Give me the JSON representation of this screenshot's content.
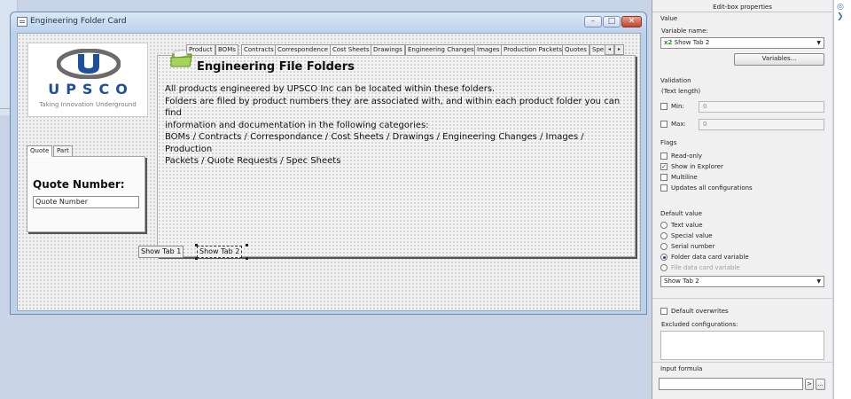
{
  "window": {
    "title": "Engineering Folder Card",
    "min_icon": "minimize-icon",
    "max_icon": "maximize-icon",
    "close_icon": "close-icon"
  },
  "logo": {
    "word": "UPSCO",
    "tagline": "Taking Innovation Underground",
    "brand_color": "#1e4f9c"
  },
  "left_tabs": [
    "Quote",
    "Part"
  ],
  "quote": {
    "label": "Quote Number:",
    "input_value": "Quote Number"
  },
  "right_tabs": [
    "Product",
    "BOMs",
    "Contracts",
    "Correspondence",
    "Cost Sheets",
    "Drawings",
    "Engineering Changes",
    "Images",
    "Production Packets",
    "Quotes",
    "Spe"
  ],
  "panel": {
    "title": "Engineering File Folders",
    "lines": [
      "All products engineered by UPSCO Inc can be located within these folders.",
      "Folders are filed by product numbers they are associated with, and within each product folder you can find",
      "information and documentation in the following categories:",
      "BOMs / Contracts / Correspondance / Cost Sheets / Drawings / Engineering Changes / Images / Production",
      "Packets / Quote Requests / Spec Sheets"
    ]
  },
  "show_tabs": {
    "tab1": "Show Tab 1",
    "tab2": "Show Tab 2"
  },
  "props": {
    "header": "Edit-box properties",
    "value_section": "Value",
    "variable_name_label": "Variable name:",
    "variable_name": "Show Tab 2",
    "variable_badge": "x2",
    "variables_button": "Variables...",
    "validation_section": "Validation",
    "validation_sub": "(Text length)",
    "min_label": "Min:",
    "min_value": "0",
    "max_label": "Max:",
    "max_value": "0",
    "flags_section": "Flags",
    "flags": [
      {
        "label": "Read-only",
        "checked": false
      },
      {
        "label": "Show in Explorer",
        "checked": true
      },
      {
        "label": "Multiline",
        "checked": false
      },
      {
        "label": "Updates all configurations",
        "checked": false
      }
    ],
    "default_section": "Default value",
    "defaults": [
      {
        "label": "Text value",
        "selected": false,
        "disabled": false
      },
      {
        "label": "Special value",
        "selected": false,
        "disabled": false
      },
      {
        "label": "Serial number",
        "selected": false,
        "disabled": false
      },
      {
        "label": "Folder data card variable",
        "selected": true,
        "disabled": false
      },
      {
        "label": "File data card variable",
        "selected": false,
        "disabled": true
      }
    ],
    "default_combo": "Show Tab 2",
    "default_overwrites": "Default overwrites",
    "excluded_label": "Excluded configurations:",
    "input_formula_label": "Input formula",
    "formula_btn1": ">",
    "formula_btn2": "..."
  }
}
